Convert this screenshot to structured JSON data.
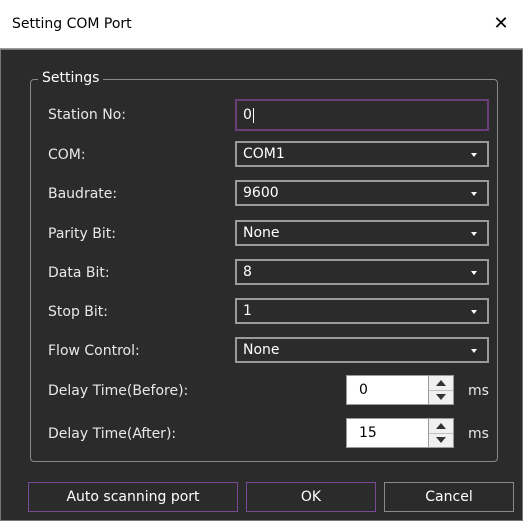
{
  "window": {
    "title": "Setting COM Port",
    "close_symbol": "✕"
  },
  "settings": {
    "group_title": "Settings",
    "station": {
      "label": "Station No:",
      "value": "0"
    },
    "com": {
      "label": "COM:",
      "value": "COM1"
    },
    "baudrate": {
      "label": "Baudrate:",
      "value": "9600"
    },
    "parity": {
      "label": "Parity Bit:",
      "value": "None"
    },
    "data_bit": {
      "label": "Data Bit:",
      "value": "8"
    },
    "stop_bit": {
      "label": "Stop Bit:",
      "value": "1"
    },
    "flow": {
      "label": "Flow Control:",
      "value": "None"
    },
    "delay_before": {
      "label": "Delay Time(Before):",
      "value": "0",
      "unit": "ms"
    },
    "delay_after": {
      "label": "Delay Time(After):",
      "value": "15",
      "unit": "ms"
    }
  },
  "buttons": {
    "auto_scan": "Auto scanning port",
    "ok": "OK",
    "cancel": "Cancel"
  },
  "colors": {
    "background": "#2b2b2b",
    "accent_border": "#7a4a9a",
    "text": "#e8e8e8"
  },
  "icons": [
    "close-icon",
    "dropdown-arrow-icon",
    "spin-up-icon",
    "spin-down-icon"
  ]
}
